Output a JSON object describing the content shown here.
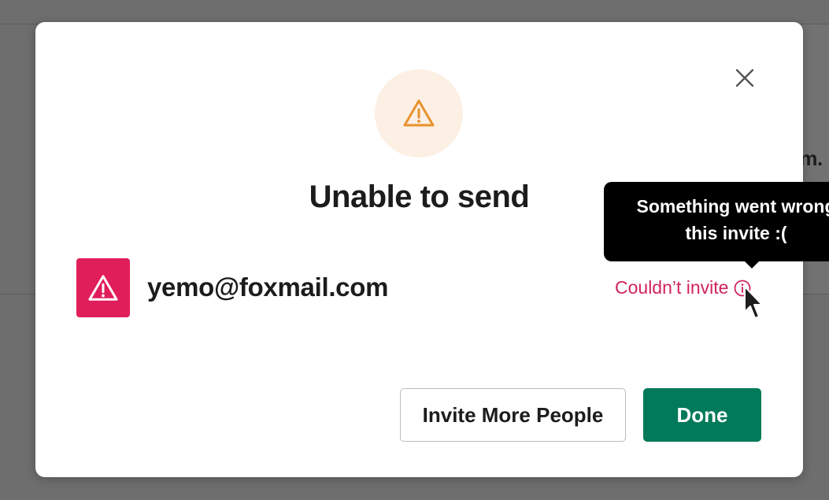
{
  "background": {
    "partial_text": "om."
  },
  "dialog": {
    "title": "Unable to send",
    "warning_icon": "warning-triangle-icon",
    "close_icon": "close-icon",
    "recipient": {
      "icon": "warning-triangle-icon",
      "email": "yemo@foxmail.com",
      "status": "Couldn’t invite",
      "status_icon": "info-circle-icon"
    },
    "buttons": {
      "invite_more": "Invite More People",
      "done": "Done"
    }
  },
  "tooltip": {
    "line1": "Something went wrong",
    "line2": "this invite :("
  },
  "colors": {
    "warning_orange": "#e8912d",
    "warning_circle_bg": "#fcefe3",
    "error_red": "#e01e5a",
    "status_text": "#d1235a",
    "primary_green": "#007a5a",
    "tooltip_bg": "#000000"
  }
}
